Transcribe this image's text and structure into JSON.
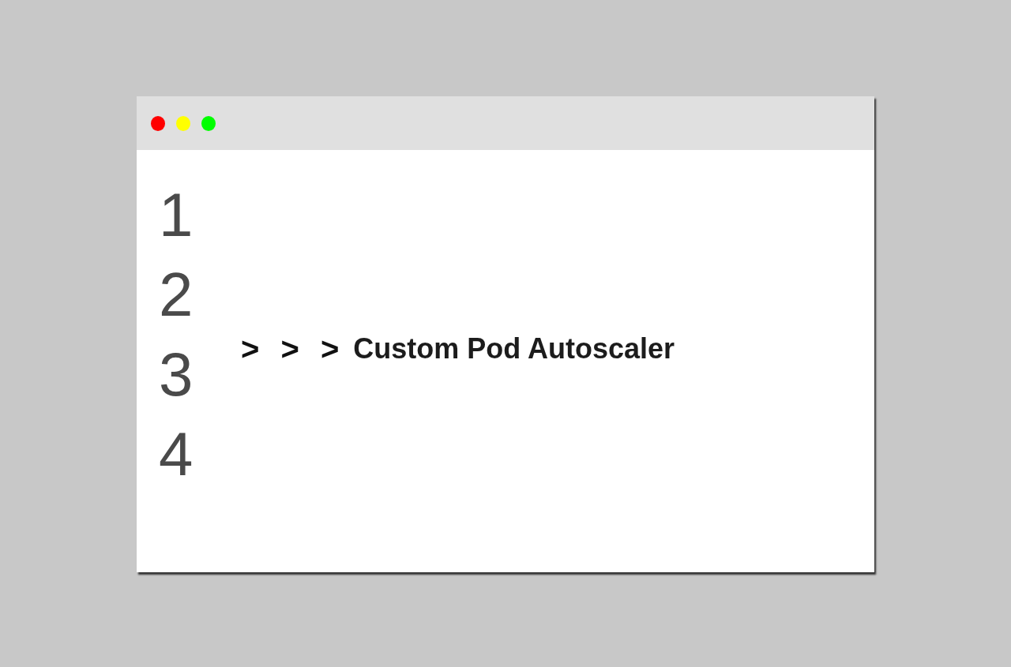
{
  "window": {
    "controls": [
      {
        "color": "#ff0000"
      },
      {
        "color": "#ffff00"
      },
      {
        "color": "#00ff00"
      }
    ],
    "editor": {
      "line_numbers": [
        "1",
        "2",
        "3",
        "4"
      ],
      "lines": [
        {
          "prompt": "> > >",
          "text": "Custom Pod Autoscaler"
        }
      ]
    }
  }
}
